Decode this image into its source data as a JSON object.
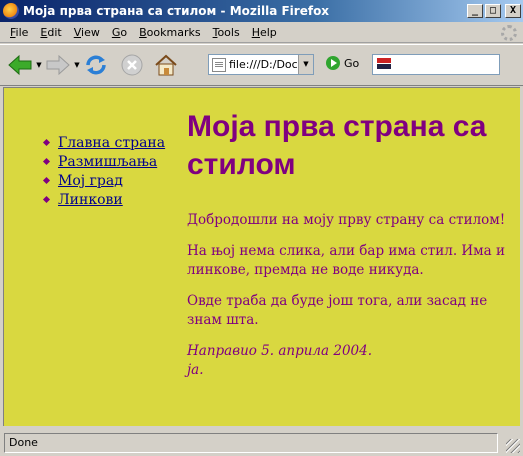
{
  "window": {
    "title": "Моја прва страна са стилом - Mozilla Firefox",
    "buttons": {
      "minimize": "_",
      "maximize": "□",
      "close": "X"
    }
  },
  "menu": {
    "items": [
      {
        "key": "F",
        "rest": "ile"
      },
      {
        "key": "E",
        "rest": "dit"
      },
      {
        "key": "V",
        "rest": "iew"
      },
      {
        "key": "G",
        "rest": "o"
      },
      {
        "key": "B",
        "rest": "ookmarks"
      },
      {
        "key": "T",
        "rest": "ools"
      },
      {
        "key": "H",
        "rest": "elp"
      }
    ]
  },
  "toolbar": {
    "url": "file:///D:/Doc",
    "go_label": "Go",
    "search_value": ""
  },
  "page": {
    "nav": [
      "Главна страна",
      "Размишљања",
      "Мој град",
      "Линкови"
    ],
    "heading": "Моја прва страна са стилом",
    "paragraphs": [
      "Добродошли на моју прву страну са стилом!",
      "На њој нема слика, али бар има стил. Има и линкове, премда не воде никуда.",
      "Овде траба да буде још тога, али засад не знам шта."
    ],
    "signature_line1": "Направио 5. априла 2004.",
    "signature_line2": "ја."
  },
  "status": {
    "text": "Done"
  },
  "colors": {
    "page_background": "#d9d840",
    "text": "#800080",
    "link": "#00008b"
  }
}
